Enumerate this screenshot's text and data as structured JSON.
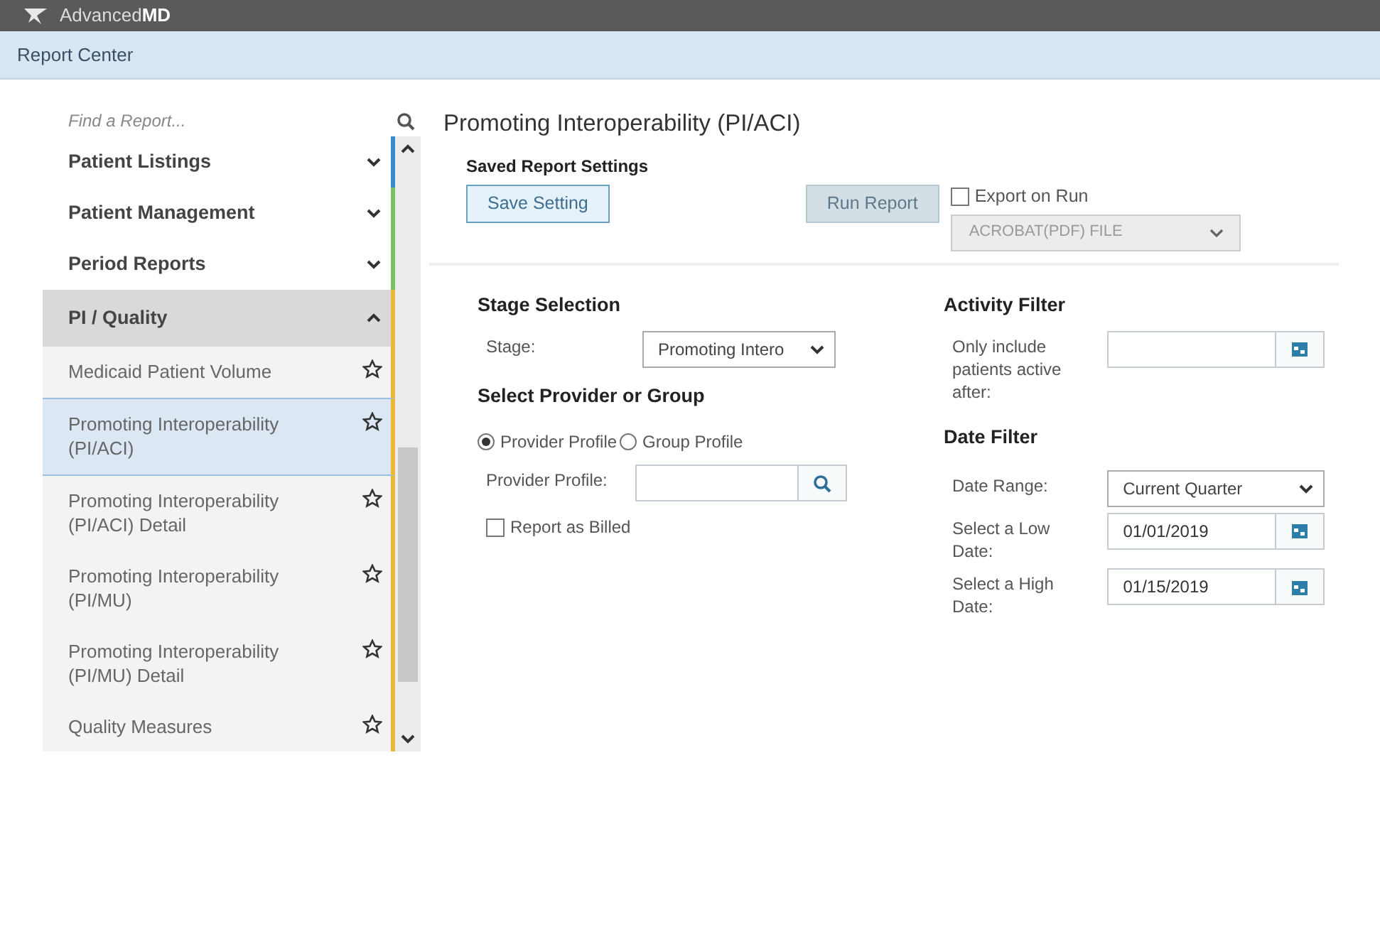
{
  "app": {
    "brand": "Advanced**MD**"
  },
  "header": {
    "title": "Report Center"
  },
  "sidebar": {
    "search": {
      "placeholder": "Find a Report..."
    },
    "groups": [
      {
        "label": "Patient Listings",
        "expanded": false,
        "color": "#3b8ad0"
      },
      {
        "label": "Patient Management",
        "expanded": false,
        "color": "#7cc06a"
      },
      {
        "label": "Period Reports",
        "expanded": false,
        "color": "#7cc06a"
      },
      {
        "label": "PI / Quality",
        "expanded": true,
        "color": "#eab93a",
        "children": [
          {
            "label": "Medicaid Patient Volume",
            "selected": false
          },
          {
            "label": "Promoting Interoperability (PI/ACI)",
            "selected": true
          },
          {
            "label": "Promoting Interoperability (PI/ACI) Detail",
            "selected": false
          },
          {
            "label": "Promoting Interoperability (PI/MU)",
            "selected": false
          },
          {
            "label": "Promoting Interoperability (PI/MU) Detail",
            "selected": false
          },
          {
            "label": "Quality Measures",
            "selected": false
          }
        ]
      }
    ]
  },
  "report": {
    "title": "Promoting Interoperability (PI/ACI)",
    "saved_settings": {
      "heading": "Saved Report Settings",
      "save_button": {
        "label": "Save Setting"
      },
      "run_button": {
        "label": "Run Report",
        "disabled": true
      },
      "export": {
        "label": "Export on Run",
        "checked": false
      },
      "format": {
        "value": "ACROBAT(PDF) FILE",
        "disabled": true
      }
    },
    "stage_selection": {
      "heading": "Stage Selection",
      "label": "Stage:",
      "value": "Promoting Intero"
    },
    "provider": {
      "heading": "Select Provider or Group",
      "radios": [
        {
          "label": "Provider Profile",
          "selected": true
        },
        {
          "label": "Group Profile",
          "selected": false
        }
      ],
      "field_label": "Provider Profile:",
      "billed": {
        "label": "Report as Billed",
        "checked": false
      }
    },
    "activity_filter": {
      "heading": "Activity Filter",
      "label": "Only include patients active after:"
    },
    "date_filter": {
      "heading": "Date Filter",
      "range": {
        "label": "Date Range:",
        "value": "Current Quarter"
      },
      "dates": [
        {
          "label": "Select a Low Date:",
          "value": "01/01/2019"
        },
        {
          "label": "Select a High Date:",
          "value": "01/15/2019"
        }
      ]
    }
  }
}
